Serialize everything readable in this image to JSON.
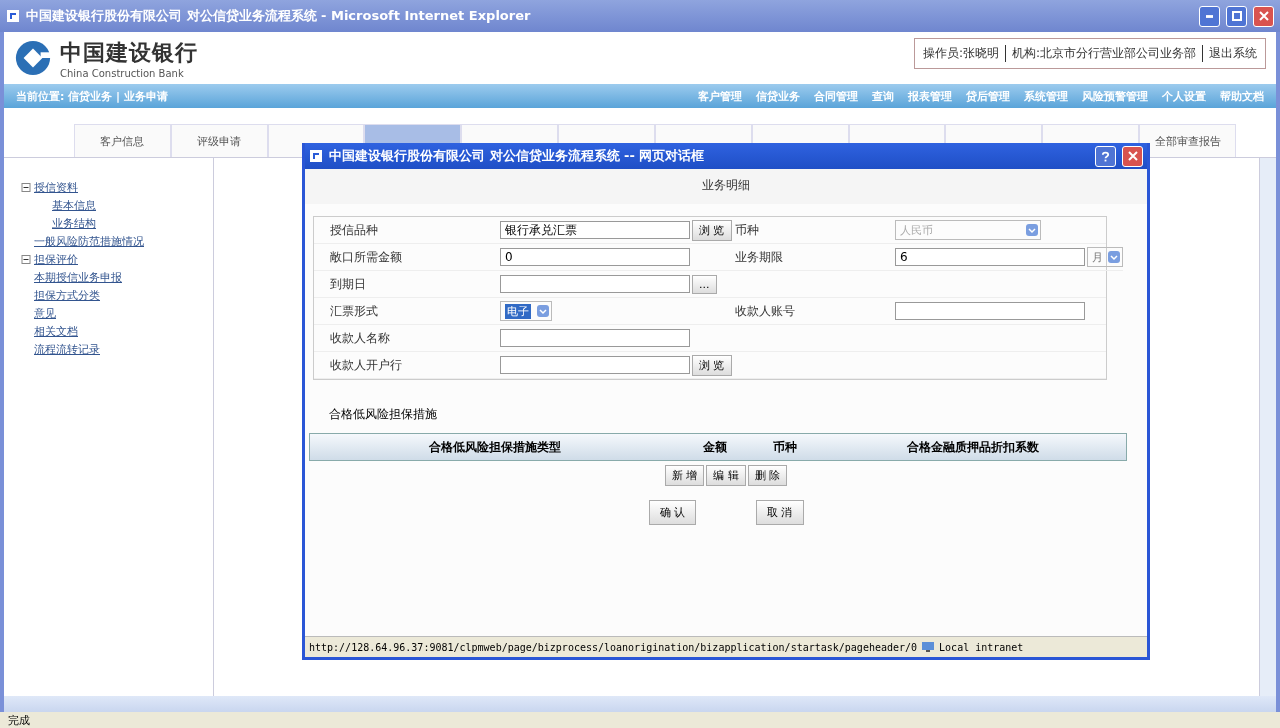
{
  "window": {
    "title": "中国建设银行股份有限公司 对公信贷业务流程系统 - Microsoft Internet Explorer"
  },
  "header": {
    "logo_cn": "中国建设银行",
    "logo_en": "China Construction Bank",
    "user_links": [
      "操作员:张晓明",
      "机构:北京市分行营业部公司业务部",
      "退出系统"
    ]
  },
  "nav": {
    "breadcrumb": "当前位置: 信贷业务 | 业务申请",
    "menu": [
      "客户管理",
      "信贷业务",
      "合同管理",
      "查询",
      "报表管理",
      "贷后管理",
      "系统管理",
      "风险预警管理",
      "个人设置",
      "帮助文档"
    ]
  },
  "tabs": [
    {
      "label": "客户信息",
      "selected": false
    },
    {
      "label": "评级申请",
      "selected": false
    },
    {
      "selected": false
    },
    {
      "selected": true
    },
    {
      "selected": false
    },
    {
      "selected": false
    },
    {
      "selected": false
    },
    {
      "selected": false
    },
    {
      "selected": false
    },
    {
      "selected": false
    },
    {
      "selected": false
    },
    {
      "label": "全部审查报告",
      "selected": false
    }
  ],
  "sidebar": {
    "tree": [
      {
        "label": "授信资料",
        "expanded": true,
        "children": [
          {
            "label": "基本信息"
          },
          {
            "label": "业务结构"
          }
        ]
      },
      {
        "label": "一般风险防范措施情况"
      },
      {
        "label": "担保评价",
        "expanded": true
      },
      {
        "label": "本期授信业务申报"
      },
      {
        "label": "担保方式分类"
      },
      {
        "label": "意见"
      },
      {
        "label": "相关文档"
      },
      {
        "label": "流程流转记录"
      }
    ]
  },
  "dialog": {
    "title": "中国建设银行股份有限公司 对公信贷业务流程系统 -- 网页对话框",
    "heading": "业务明细",
    "rows": [
      {
        "left": {
          "label": "授信品种",
          "kind": "text",
          "value": "银行承兑汇票",
          "button": "浏 览"
        },
        "right": {
          "label": "币种",
          "kind": "select",
          "value": "人民币",
          "disabled": true
        }
      },
      {
        "left": {
          "label": "敞口所需金额",
          "kind": "text",
          "value": "0"
        },
        "right": {
          "label": "业务期限",
          "kind": "text",
          "value": "6",
          "unit": "月"
        }
      },
      {
        "left": {
          "label": "到期日",
          "kind": "text",
          "button": "..."
        }
      },
      {
        "left": {
          "label": "汇票形式",
          "kind": "select",
          "value": "电子",
          "highlighted": true
        },
        "right": {
          "label": "收款人账号",
          "kind": "text"
        }
      },
      {
        "left": {
          "label": "收款人名称",
          "kind": "text"
        }
      },
      {
        "left": {
          "label": "收款人开户行",
          "kind": "text",
          "button": "浏 览"
        }
      }
    ],
    "section": "合格低风险担保措施",
    "columns": [
      "合格低风险担保措施类型",
      "金额",
      "币种",
      "合格金融质押品折扣系数"
    ],
    "table_buttons": [
      "新 增",
      "编 辑",
      "删 除"
    ],
    "buttons": [
      "确 认",
      "取 消"
    ],
    "status_url": "http://128.64.96.37:9081/clpmweb/page/bizprocess/loanorigination/bizapplication/startask/pageheader/0",
    "zone": "Local intranet"
  },
  "status_bar": {
    "text": "完成"
  }
}
